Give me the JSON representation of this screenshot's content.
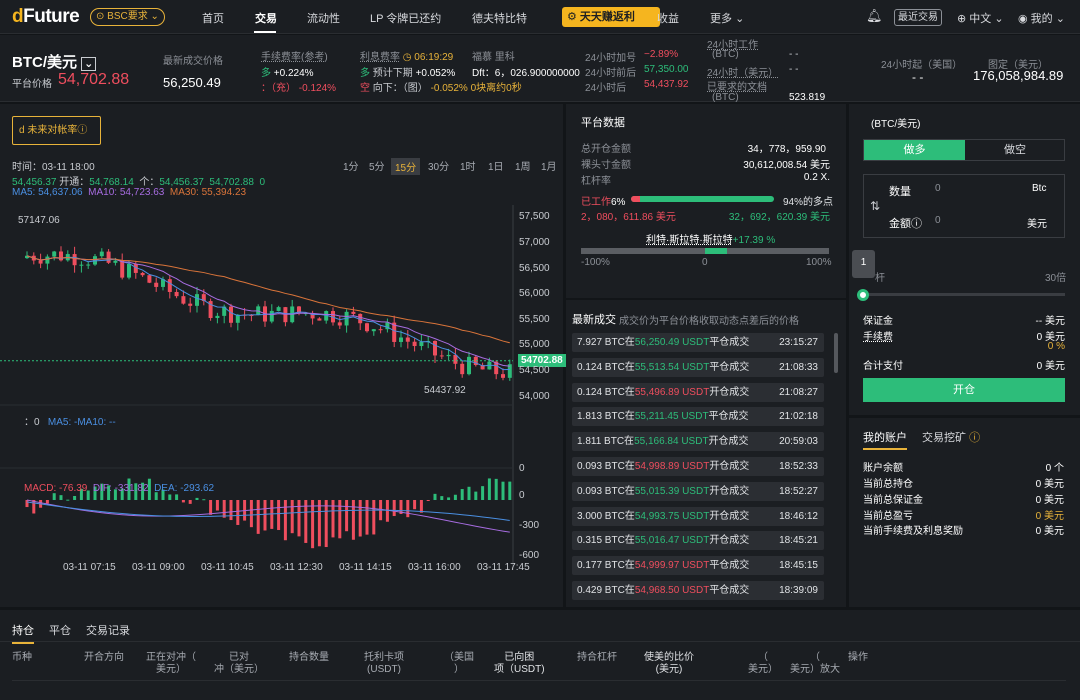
{
  "nav": {
    "logo_a": "d",
    "logo_b": "Future",
    "network": "BSC要求",
    "items": [
      "首页",
      "交易",
      "流动性",
      "LP 令牌已还约",
      "德夫特比特",
      "收益",
      "更多"
    ],
    "earn": "天天赚返利",
    "recent": "最近交易",
    "lang": "中文",
    "mine": "我的"
  },
  "ticker": {
    "pair": "BTC/美元",
    "platform_price_label": "平台价格",
    "platform_price": "54,702.88",
    "last_label": "最新成交价格",
    "last_value": "56,250.49",
    "fee_label": "手续费率(参考)",
    "fee_long_label": "多",
    "fee_long": "+0.224%",
    "fee_short_label": "：（充）",
    "fee_short": "-0.124%",
    "interest_label": "利息费率",
    "interest_time": "06:19:29",
    "int_long_label": "多",
    "int_long_text": "预计下期",
    "int_long": "+0.052%",
    "int_short_label": "空",
    "int_short_text": "向下：（图）",
    "int_short": "-0.052%",
    "int_blocks": "0块离约0秒",
    "fusu_label": "福慕 里科",
    "fusu_df": "Dft：6，026.900000000",
    "h_inc_label": "24小时加号",
    "h_inc": "−2.89%",
    "h_after_label": "24小时前后",
    "h_after": "57,350.00",
    "h_low_label": "24小时后",
    "h_low": "54,437.92",
    "work_label": "24小时工作",
    "work_sub": "(BTC)",
    "work_val": "- -",
    "usd_label": "24小时（美元）",
    "usd_val": "- -",
    "doc_label": "已要求的文档",
    "doc_sub": "(BTC)",
    "doc_val": "523.819",
    "usnet_label": "24小时起（美国）",
    "usnet_val": "- -",
    "ext_label": "图定（美元）",
    "ext_val": "176,058,984.89"
  },
  "chart": {
    "funding_btn": "d 未来对帐率",
    "timeframes": [
      "1分",
      "5分",
      "15分",
      "30分",
      "1时",
      "1日",
      "1周",
      "1月"
    ],
    "selected_tf": "15分",
    "info_time": "时间：03-11 18:00",
    "info_open_val": "54,456.37",
    "info_open_label": "开通：",
    "info_high": "54,768.14",
    "info_low_label": "个：",
    "info_low": "54,456.37",
    "info_close": "54,702.88",
    "info_chg": "0",
    "ma5": "MA5: 54,637.06",
    "ma10": "MA10: 54,723.63",
    "ma30": "MA30: 55,394.23",
    "high_label": "57147.06",
    "low_label": "54437.92",
    "current_price": "54702.88",
    "vol_label": "：0",
    "vol_ma": "MA5: -MA10: --",
    "macd": "MACD: -76.39",
    "dif": "DIF: -331.82",
    "dea": "DEA: -293.62",
    "price_ticks": [
      "57,500",
      "57,000",
      "56,500",
      "56,000",
      "55,500",
      "55,000",
      "54,500",
      "54,000"
    ],
    "vol_ticks": [
      "0"
    ],
    "macd_ticks": [
      "0",
      "-300",
      "-600"
    ],
    "time_ticks": [
      "03-11 07:15",
      "03-11 09:00",
      "03-11 10:45",
      "03-11 12:30",
      "03-11 14:15",
      "03-11 16:00",
      "03-11 17:45"
    ]
  },
  "platform": {
    "title": "平台数据",
    "rows": [
      {
        "label": "总开仓金额",
        "value": "34，778，959.90"
      },
      {
        "label": "裸头寸金额",
        "value": "30,612,008.54 美元"
      },
      {
        "label": "杠杆率",
        "value": "0.2 X."
      }
    ],
    "work_label": "已工作",
    "work_pct": "6%",
    "long_pct": "94%的多点",
    "left_amt": "2，080，611.86 美元",
    "right_amt": "32，692，620.39 美元",
    "ratio_label": "利特·斯拉特·斯拉特",
    "ratio_val": "+17.39 %",
    "scale": [
      "-100%",
      "0",
      "100%"
    ]
  },
  "trades": {
    "title": "最新成交",
    "subtitle": "成交价为平台价格收取动态点差后的价格",
    "rows": [
      {
        "qty": "7.927 BTC在",
        "price": "56,250.49 USDT",
        "side": "g",
        "suffix": "平仓成交",
        "time": "23:15:27"
      },
      {
        "qty": "0.124 BTC在",
        "price": "55,513.54 USDT",
        "side": "g",
        "suffix": "平仓成交",
        "time": "21:08:33"
      },
      {
        "qty": "0.124 BTC在",
        "price": "55,496.89 USDT",
        "side": "r",
        "suffix": "开仓成交",
        "time": "21:08:27"
      },
      {
        "qty": "1.813 BTC在",
        "price": "55,211.45 USDT",
        "side": "g",
        "suffix": "平仓成交",
        "time": "21:02:18"
      },
      {
        "qty": "1.811 BTC在",
        "price": "55,166.84 USDT",
        "side": "g",
        "suffix": "开仓成交",
        "time": "20:59:03"
      },
      {
        "qty": "0.093 BTC在",
        "price": "54,998.89 USDT",
        "side": "r",
        "suffix": "开仓成交",
        "time": "18:52:33"
      },
      {
        "qty": "0.093 BTC在",
        "price": "55,015.39 USDT",
        "side": "g",
        "suffix": "开仓成交",
        "time": "18:52:27"
      },
      {
        "qty": "3.000 BTC在",
        "price": "54,993.75 USDT",
        "side": "g",
        "suffix": "开仓成交",
        "time": "18:46:12"
      },
      {
        "qty": "0.315 BTC在",
        "price": "55,016.47 USDT",
        "side": "g",
        "suffix": "开仓成交",
        "time": "18:45:21"
      },
      {
        "qty": "0.177 BTC在",
        "price": "54,999.97 USDT",
        "side": "r",
        "suffix": "平仓成交",
        "time": "18:45:15"
      },
      {
        "qty": "0.429 BTC在",
        "price": "54,968.50 USDT",
        "side": "r",
        "suffix": "平仓成交",
        "time": "18:39:09"
      }
    ]
  },
  "order": {
    "pair": "(BTC/美元)",
    "long": "做多",
    "short": "做空",
    "qty_label": "数量",
    "qty_val": "0",
    "qty_unit": "Btc",
    "amt_label": "金额",
    "amt_val": "0",
    "amt_unit": "美元",
    "lev_badge": "1",
    "lev_label": "杆",
    "lev_max": "30倍",
    "rows": [
      {
        "label": "保证金",
        "value": "-- 美元"
      },
      {
        "label": "手续费",
        "value": "0 美元"
      }
    ],
    "pct": "0 %",
    "total_label": "合计支付",
    "total_value": "0 美元",
    "open_btn": "开仓"
  },
  "account": {
    "tab1": "我的账户",
    "tab2": "交易挖矿",
    "rows": [
      {
        "label": "账户余额",
        "value": "0 个"
      },
      {
        "label": "当前总持仓",
        "value": "0 美元"
      },
      {
        "label": "当前总保证金",
        "value": "0 美元"
      },
      {
        "label": "当前总盈亏",
        "value": "0 美元"
      },
      {
        "label": "当前手续费及利息奖励",
        "value": "0 美元"
      }
    ]
  },
  "bottom": {
    "tabs": [
      "持仓",
      "平仓",
      "交易记录"
    ],
    "cols": [
      "币种",
      "开合方向",
      "正在对冲（\n美元）",
      "已对\n冲（美元）",
      "持合数量",
      "托利卡项\n(USDT)",
      "（美国\n）",
      "已向困\n项（USDT)",
      "持合杠杆",
      "使美的比价\n(美元)",
      "（\n美元）",
      "（\n美元）放大",
      "操作"
    ]
  },
  "colors": {
    "green": "#2dbd7a",
    "red": "#ef4e5e",
    "accent": "#f5b51f"
  }
}
